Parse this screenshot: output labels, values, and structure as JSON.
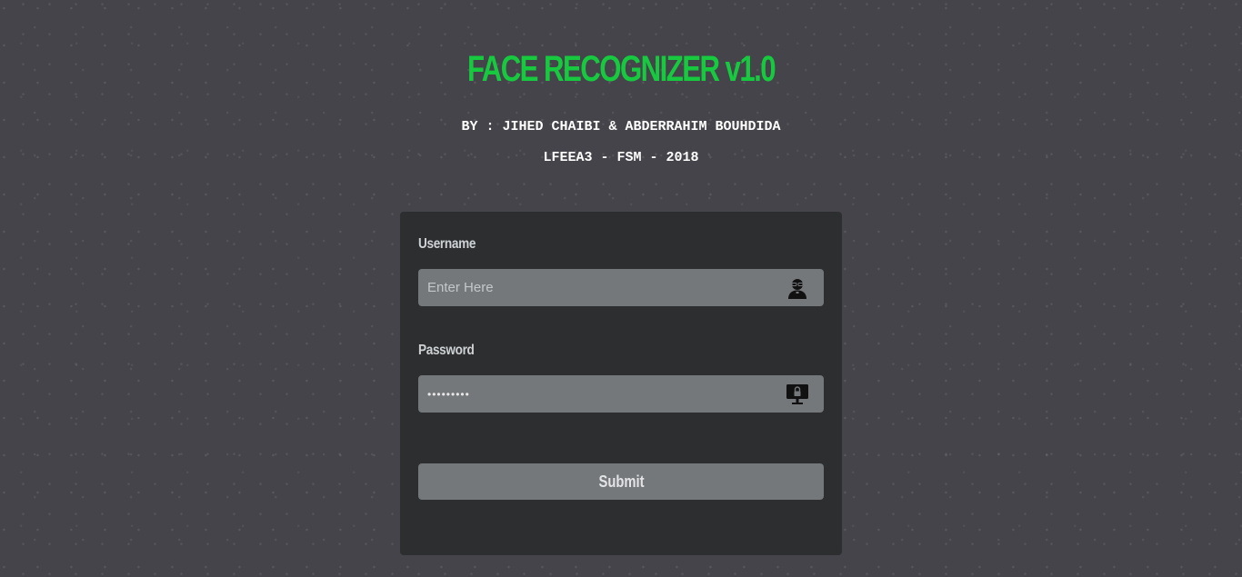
{
  "header": {
    "title": "FACE RECOGNIZER v1.0",
    "authors": "BY : JIHED CHAIBI & ABDERRAHIM BOUHDIDA",
    "course": "LFEEA3 - FSM - 2018"
  },
  "form": {
    "username_label": "Username",
    "username_placeholder": "Enter Here",
    "username_icon": "user-icon",
    "password_label": "Password",
    "password_value": "•••••••••",
    "password_icon": "lock-screen-icon",
    "submit_label": "Submit"
  },
  "colors": {
    "title": "#17c93f",
    "background": "#44444a",
    "panel": "#2c2e30",
    "input": "#75787b"
  }
}
